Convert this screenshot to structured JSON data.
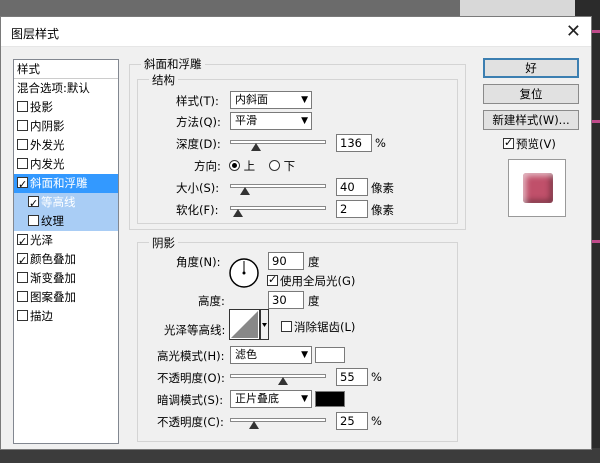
{
  "dialog": {
    "title": "图层样式",
    "close_icon": "close-icon"
  },
  "styles_list": {
    "items": [
      {
        "label": "样式",
        "checkbox": false,
        "checked": false,
        "state": "head"
      },
      {
        "label": "混合选项:默认",
        "checkbox": false,
        "checked": false,
        "state": "normal"
      },
      {
        "label": "投影",
        "checkbox": true,
        "checked": false,
        "state": "normal"
      },
      {
        "label": "内阴影",
        "checkbox": true,
        "checked": false,
        "state": "normal"
      },
      {
        "label": "外发光",
        "checkbox": true,
        "checked": false,
        "state": "normal"
      },
      {
        "label": "内发光",
        "checkbox": true,
        "checked": false,
        "state": "normal"
      },
      {
        "label": "斜面和浮雕",
        "checkbox": true,
        "checked": true,
        "state": "selected"
      },
      {
        "label": "等高线",
        "checkbox": true,
        "checked": true,
        "state": "sub"
      },
      {
        "label": "纹理",
        "checkbox": true,
        "checked": false,
        "state": "sub"
      },
      {
        "label": "光泽",
        "checkbox": true,
        "checked": true,
        "state": "normal"
      },
      {
        "label": "颜色叠加",
        "checkbox": true,
        "checked": true,
        "state": "normal"
      },
      {
        "label": "渐变叠加",
        "checkbox": true,
        "checked": false,
        "state": "normal"
      },
      {
        "label": "图案叠加",
        "checkbox": true,
        "checked": false,
        "state": "normal"
      },
      {
        "label": "描边",
        "checkbox": true,
        "checked": false,
        "state": "normal"
      }
    ]
  },
  "bevel": {
    "group_title": "斜面和浮雕",
    "structure_title": "结构",
    "style_label": "样式(T):",
    "style_value": "内斜面",
    "technique_label": "方法(Q):",
    "technique_value": "平滑",
    "depth_label": "深度(D):",
    "depth_value": "136",
    "depth_unit": "%",
    "depth_level": 0.27,
    "direction_label": "方向:",
    "direction_up": "上",
    "direction_down": "下",
    "direction_selected": "上",
    "size_label": "大小(S):",
    "size_value": "40",
    "size_unit": "像素",
    "size_level": 0.16,
    "soften_label": "软化(F):",
    "soften_value": "2",
    "soften_unit": "像素",
    "soften_level": 0.08
  },
  "shading": {
    "title": "阴影",
    "angle_label": "角度(N):",
    "angle_value": "90",
    "angle_unit": "度",
    "global_light_label": "使用全局光(G)",
    "global_light_checked": true,
    "altitude_label": "高度:",
    "altitude_value": "30",
    "altitude_unit": "度",
    "gloss_contour_label": "光泽等高线:",
    "anti_alias_label": "消除锯齿(L)",
    "anti_alias_checked": false,
    "highlight_mode_label": "高光模式(H):",
    "highlight_mode_value": "滤色",
    "highlight_color": "#ffffff",
    "highlight_opacity_label": "不透明度(O):",
    "highlight_opacity_value": "55",
    "highlight_opacity_level": 0.55,
    "shadow_mode_label": "暗调模式(S):",
    "shadow_mode_value": "正片叠底",
    "shadow_color": "#000000",
    "shadow_opacity_label": "不透明度(C):",
    "shadow_opacity_value": "25",
    "shadow_opacity_level": 0.25,
    "percent": "%"
  },
  "buttons": {
    "ok": "好",
    "reset": "复位",
    "new_style": "新建样式(W)...",
    "preview_label": "预览(V)",
    "preview_checked": true
  },
  "colors": {
    "selection": "#3399ff",
    "preview_swatch": "#c0506a"
  }
}
